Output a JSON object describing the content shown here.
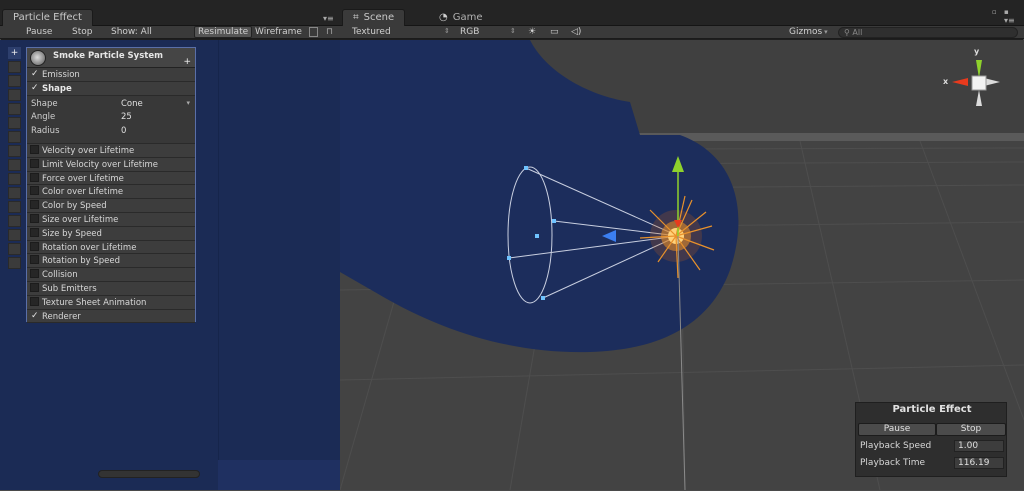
{
  "left_panel": {
    "tab_title": "Particle Effect",
    "toolbar": {
      "pause": "Pause",
      "stop": "Stop",
      "show": "Show: All",
      "resimulate": "Resimulate",
      "wireframe": "Wireframe"
    },
    "system_name": "Smoke Particle System",
    "modules_top": [
      {
        "label": "Emission",
        "enabled": true,
        "bold": false
      },
      {
        "label": "Shape",
        "enabled": true,
        "bold": true
      }
    ],
    "shape_properties": [
      {
        "label": "Shape",
        "value": "Cone",
        "dropdown": true
      },
      {
        "label": "Angle",
        "value": "25"
      },
      {
        "label": "Radius",
        "value": "0"
      }
    ],
    "modules_bottom": [
      {
        "label": "Velocity over Lifetime",
        "enabled": false
      },
      {
        "label": "Limit Velocity over Lifetime",
        "enabled": false
      },
      {
        "label": "Force over Lifetime",
        "enabled": false
      },
      {
        "label": "Color over Lifetime",
        "enabled": false
      },
      {
        "label": "Color by Speed",
        "enabled": false
      },
      {
        "label": "Size over Lifetime",
        "enabled": false
      },
      {
        "label": "Size by Speed",
        "enabled": false
      },
      {
        "label": "Rotation over Lifetime",
        "enabled": false
      },
      {
        "label": "Rotation by Speed",
        "enabled": false
      },
      {
        "label": "Collision",
        "enabled": false
      },
      {
        "label": "Sub Emitters",
        "enabled": false
      },
      {
        "label": "Texture Sheet Animation",
        "enabled": false
      },
      {
        "label": "Renderer",
        "enabled": true
      }
    ]
  },
  "scene": {
    "tabs": [
      {
        "label": "Scene",
        "icon": "grid-icon",
        "active": true
      },
      {
        "label": "Game",
        "icon": "pacman-icon",
        "active": false
      }
    ],
    "toolbar": {
      "render_mode": "Textured",
      "color_mode": "RGB",
      "gizmos": "Gizmos",
      "search_placeholder": "All"
    },
    "axis_labels": {
      "x": "x",
      "y": "y"
    },
    "colors": {
      "selection_blue": "#1c2d5c",
      "x_axis": "#e83a1d",
      "y_axis": "#8fd22c",
      "z_axis": "#3b7ef0"
    }
  },
  "particle_effect_overlay": {
    "title": "Particle Effect",
    "pause": "Pause",
    "stop": "Stop",
    "playback_speed_label": "Playback Speed",
    "playback_speed": "1.00",
    "playback_time_label": "Playback Time",
    "playback_time": "116.19"
  }
}
